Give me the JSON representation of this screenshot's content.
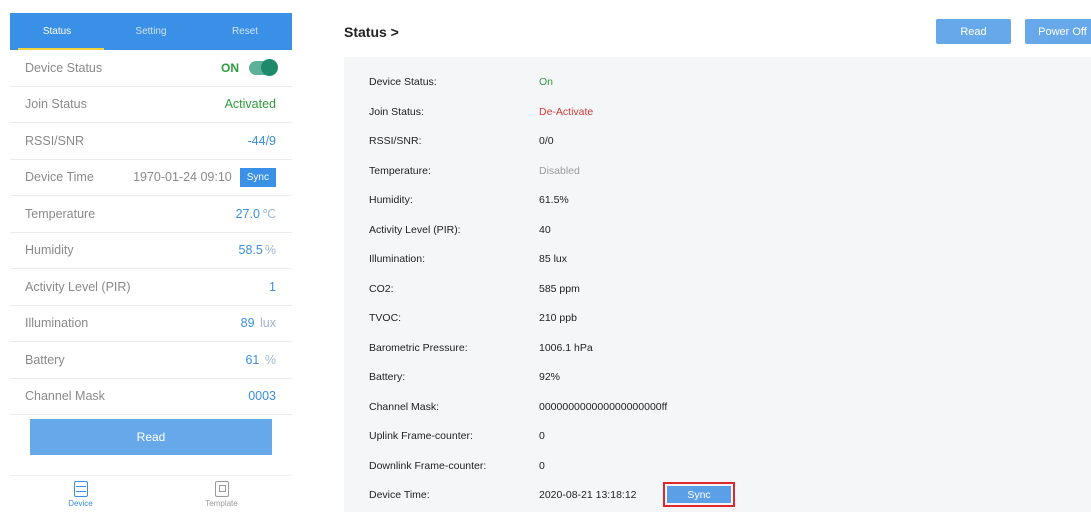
{
  "mobile": {
    "tabs": [
      {
        "label": "Status"
      },
      {
        "label": "Setting"
      },
      {
        "label": "Reset"
      }
    ],
    "device_status": {
      "label": "Device Status",
      "value": "ON"
    },
    "join_status": {
      "label": "Join Status",
      "value": "Activated"
    },
    "rssi": {
      "label": "RSSI/SNR",
      "value": "-44/9"
    },
    "device_time": {
      "label": "Device Time",
      "value": "1970-01-24 09:10",
      "sync_label": "Sync"
    },
    "temperature": {
      "label": "Temperature",
      "value": "27.0",
      "unit": "℃"
    },
    "humidity": {
      "label": "Humidity",
      "value": "58.5",
      "unit": "%"
    },
    "activity": {
      "label": "Activity Level (PIR)",
      "value": "1"
    },
    "illumination": {
      "label": "Illumination",
      "value": "89",
      "unit": "lux"
    },
    "battery": {
      "label": "Battery",
      "value": "61",
      "unit": "%"
    },
    "channel_mask": {
      "label": "Channel Mask",
      "value": "0003"
    },
    "read_label": "Read",
    "nav": [
      {
        "label": "Device",
        "icon": "device-icon"
      },
      {
        "label": "Template",
        "icon": "template-icon"
      }
    ]
  },
  "web": {
    "title": "Status >",
    "read_label": "Read",
    "power_off_label": "Power Off",
    "rows": [
      {
        "key": "Device Status:",
        "value": "On"
      },
      {
        "key": "Join Status:",
        "value": "De-Activate"
      },
      {
        "key": "RSSI/SNR:",
        "value": "0/0"
      },
      {
        "key": "Temperature:",
        "value": "Disabled"
      },
      {
        "key": "Humidity:",
        "value": "61.5%"
      },
      {
        "key": "Activity Level (PIR):",
        "value": "40"
      },
      {
        "key": "Illumination:",
        "value": "85 lux"
      },
      {
        "key": "CO2:",
        "value": "585 ppm"
      },
      {
        "key": "TVOC:",
        "value": "210 ppb"
      },
      {
        "key": "Barometric Pressure:",
        "value": "1006.1 hPa"
      },
      {
        "key": "Battery:",
        "value": "92%"
      },
      {
        "key": "Channel Mask:",
        "value": "000000000000000000000ff"
      },
      {
        "key": "Uplink Frame-counter:",
        "value": "0"
      },
      {
        "key": "Downlink Frame-counter:",
        "value": "0"
      },
      {
        "key": "Device Time:",
        "value": "2020-08-21 13:18:12"
      }
    ],
    "sync_label": "Sync"
  },
  "colors": {
    "accent": "#3a8fe6",
    "button": "#66a8ea",
    "green": "#2e9b3e",
    "red": "#d43a3a",
    "highlight": "#e0282c"
  }
}
